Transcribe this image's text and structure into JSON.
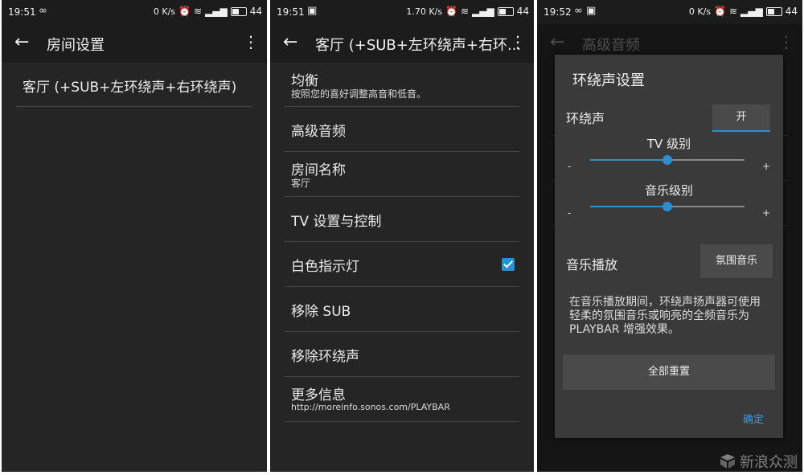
{
  "colors": {
    "accent": "#2d8fd0",
    "panel_bg": "#252525",
    "bar_bg": "#1c1c1c",
    "dialog_bg": "#3a3a3a"
  },
  "panel1": {
    "status": {
      "time": "19:51",
      "left_icons": "∞",
      "speed": "0 K/s",
      "battery": "44"
    },
    "title": "房间设置",
    "items": [
      {
        "label": "客厅 (+SUB+左环绕声+右环绕声)"
      }
    ]
  },
  "panel2": {
    "status": {
      "time": "19:51",
      "left_icons": "▣",
      "speed": "1.70 K/s",
      "battery": "44"
    },
    "title": "客厅 (+SUB+左环绕声+右环...",
    "items": [
      {
        "label": "均衡",
        "sub": "按照您的喜好调整高音和低音。"
      },
      {
        "label": "高级音频"
      },
      {
        "label": "房间名称",
        "sub": "客厅"
      },
      {
        "label": "TV 设置与控制"
      },
      {
        "label": "白色指示灯",
        "checked": true
      },
      {
        "label": "移除 SUB"
      },
      {
        "label": "移除环绕声"
      },
      {
        "label": "更多信息",
        "sub": "http://moreinfo.sonos.com/PLAYBAR"
      }
    ]
  },
  "panel3": {
    "status": {
      "time": "19:52",
      "left_icons": "∞ ▣",
      "speed": "0 K/s",
      "battery": "44"
    },
    "title": "高级音频",
    "dialog": {
      "title": "环绕声设置",
      "surround_label": "环绕声",
      "surround_toggle": "开",
      "tv_level_label": "TV 级别",
      "tv_level_value": 0.5,
      "music_level_label": "音乐级别",
      "music_level_value": 0.5,
      "minus": "-",
      "plus": "+",
      "music_play_label": "音乐播放",
      "music_play_value": "氛围音乐",
      "description": "在音乐播放期间，环绕声扬声器可使用轻柔的氛围音乐或响亮的全频音乐为 PLAYBAR 增强效果。",
      "reset_button": "全部重置",
      "ok_button": "确定"
    }
  },
  "watermark": "新浪众测"
}
